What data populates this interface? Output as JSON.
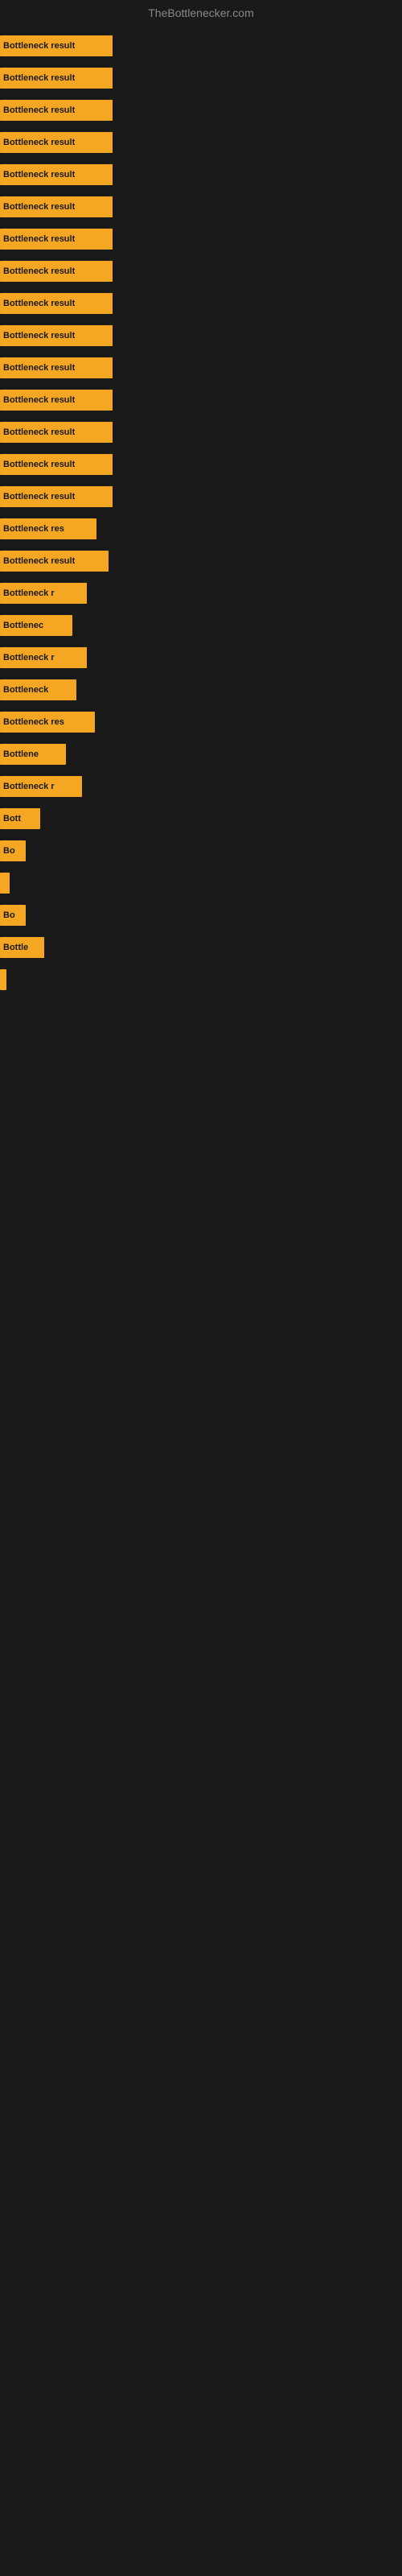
{
  "header": {
    "title": "TheBottlenecker.com"
  },
  "bars": [
    {
      "label": "Bottleneck result",
      "width": 140
    },
    {
      "label": "Bottleneck result",
      "width": 140
    },
    {
      "label": "Bottleneck result",
      "width": 140
    },
    {
      "label": "Bottleneck result",
      "width": 140
    },
    {
      "label": "Bottleneck result",
      "width": 140
    },
    {
      "label": "Bottleneck result",
      "width": 140
    },
    {
      "label": "Bottleneck result",
      "width": 140
    },
    {
      "label": "Bottleneck result",
      "width": 140
    },
    {
      "label": "Bottleneck result",
      "width": 140
    },
    {
      "label": "Bottleneck result",
      "width": 140
    },
    {
      "label": "Bottleneck result",
      "width": 140
    },
    {
      "label": "Bottleneck result",
      "width": 140
    },
    {
      "label": "Bottleneck result",
      "width": 140
    },
    {
      "label": "Bottleneck result",
      "width": 140
    },
    {
      "label": "Bottleneck result",
      "width": 140
    },
    {
      "label": "Bottleneck res",
      "width": 120
    },
    {
      "label": "Bottleneck result",
      "width": 135
    },
    {
      "label": "Bottleneck r",
      "width": 108
    },
    {
      "label": "Bottlenec",
      "width": 90
    },
    {
      "label": "Bottleneck r",
      "width": 108
    },
    {
      "label": "Bottleneck ",
      "width": 95
    },
    {
      "label": "Bottleneck res",
      "width": 118
    },
    {
      "label": "Bottlene",
      "width": 82
    },
    {
      "label": "Bottleneck r",
      "width": 102
    },
    {
      "label": "Bott",
      "width": 50
    },
    {
      "label": "Bo",
      "width": 32
    },
    {
      "label": "",
      "width": 12
    },
    {
      "label": "Bo",
      "width": 32
    },
    {
      "label": "Bottle",
      "width": 55
    },
    {
      "label": "",
      "width": 8
    }
  ]
}
